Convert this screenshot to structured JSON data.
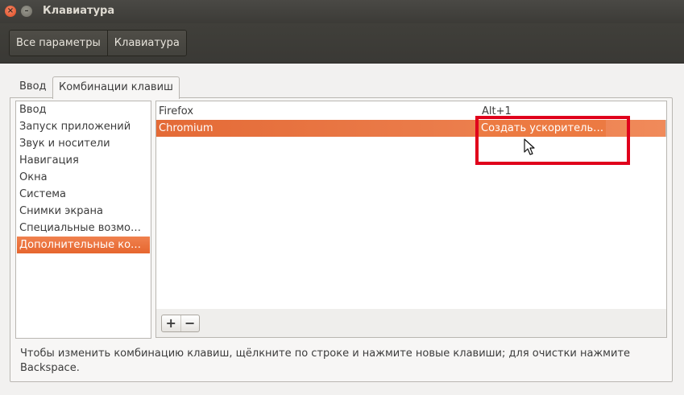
{
  "window": {
    "title": "Клавиатура"
  },
  "breadcrumb": [
    "Все параметры",
    "Клавиатура"
  ],
  "tabs": [
    {
      "label": "Ввод",
      "active": false
    },
    {
      "label": "Комбинации клавиш",
      "active": true
    }
  ],
  "categories": [
    "Ввод",
    "Запуск приложений",
    "Звук и носители",
    "Навигация",
    "Окна",
    "Система",
    "Снимки экрана",
    "Специальные возмо…",
    "Дополнительные ко…"
  ],
  "selected_category_index": 8,
  "shortcuts": [
    {
      "name": "Firefox",
      "accel": "Alt+1"
    },
    {
      "name": "Chromium",
      "accel": "Создать ускоритель…"
    }
  ],
  "selected_shortcut_index": 1,
  "buttons": {
    "add": "+",
    "remove": "−"
  },
  "hint": "Чтобы изменить комбинацию клавиш, щёлкните по строке и нажмите новые клавиши; для очистки нажмите Backspace.",
  "colors": {
    "accent": "#e6662f",
    "highlight_box": "#e0001b"
  },
  "icons": {
    "close": "close-icon",
    "minimize": "minimize-icon",
    "cursor": "mouse-pointer-icon"
  }
}
